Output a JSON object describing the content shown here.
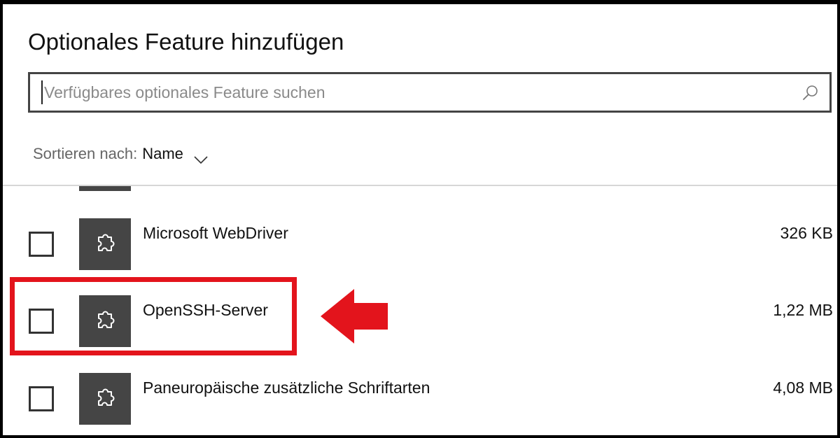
{
  "dialog": {
    "title": "Optionales Feature hinzufügen"
  },
  "search": {
    "placeholder": "Verfügbares optionales Feature suchen",
    "value": "",
    "icon": "search-icon"
  },
  "sort": {
    "label": "Sortieren nach:",
    "value": "Name",
    "icon": "chevron-down-icon"
  },
  "features": [
    {
      "name": "Microsoft WebDriver",
      "size": "326 KB",
      "checked": false,
      "icon": "puzzle-icon"
    },
    {
      "name": "OpenSSH-Server",
      "size": "1,22 MB",
      "checked": false,
      "icon": "puzzle-icon"
    },
    {
      "name": "Paneuropäische zusätzliche Schriftarten",
      "size": "4,08 MB",
      "checked": false,
      "icon": "puzzle-icon"
    }
  ],
  "annotation": {
    "highlight_color": "#e3141c",
    "highlighted_feature": "OpenSSH-Server"
  },
  "colors": {
    "tile": "#454545",
    "text": "#111111",
    "muted_text": "#666666",
    "placeholder": "#8a8a8a"
  }
}
